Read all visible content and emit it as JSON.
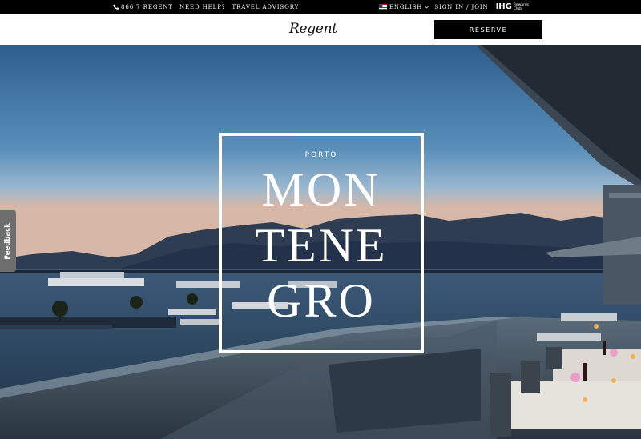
{
  "utility_bar": {
    "phone": "866 7 REGENT",
    "need_help": "NEED HELP?",
    "travel_advisory": "TRAVEL ADVISORY",
    "language": "ENGLISH",
    "language_flag_icon": "us-flag-icon",
    "sign_in": "SIGN IN / JOIN",
    "ihg_mark": "IHG",
    "ihg_sub_1": "Rewards",
    "ihg_sub_2": "Club"
  },
  "header": {
    "logo": "Regent",
    "reserve_label": "RESERVE"
  },
  "hero": {
    "eyebrow": "PORTO",
    "title_lines": [
      "MON",
      "TENE",
      "GRO"
    ],
    "image_description_icon": "marina-terrace-dusk-photo"
  },
  "feedback": {
    "label": "Feedback"
  },
  "colors": {
    "utility_bg": "#000000",
    "header_bg": "#ffffff",
    "reserve_bg": "#000000",
    "feedback_bg": "#6e6e6e"
  }
}
